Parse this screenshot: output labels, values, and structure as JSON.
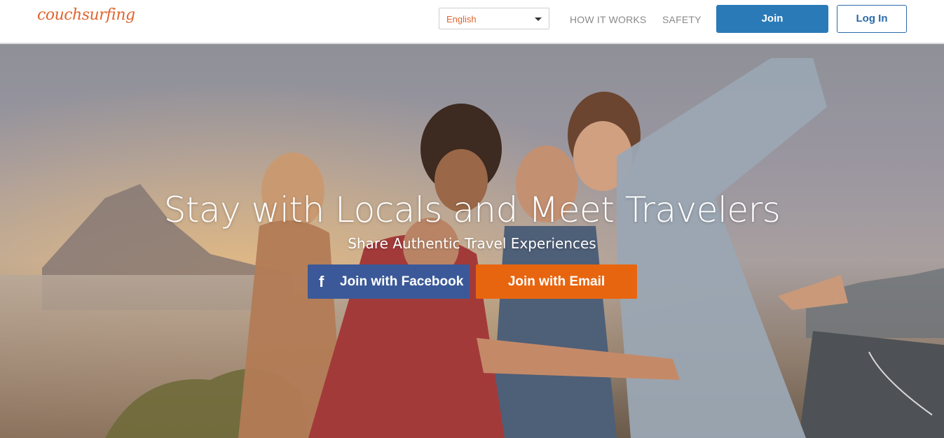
{
  "header": {
    "logo_text": "couchsurfing",
    "language": "English",
    "nav": {
      "how_it_works": "HOW IT WORKS",
      "safety": "SAFETY"
    },
    "join_label": "Join",
    "login_label": "Log In"
  },
  "hero": {
    "title": "Stay with Locals and Meet Travelers",
    "subtitle": "Share Authentic Travel Experiences",
    "facebook_icon": "f",
    "facebook_label": "Join with Facebook",
    "email_label": "Join with Email"
  },
  "colors": {
    "brand_orange": "#e0652d",
    "join_blue": "#2a7ab8",
    "facebook_blue": "#3b5998",
    "email_orange": "#e8650f"
  }
}
